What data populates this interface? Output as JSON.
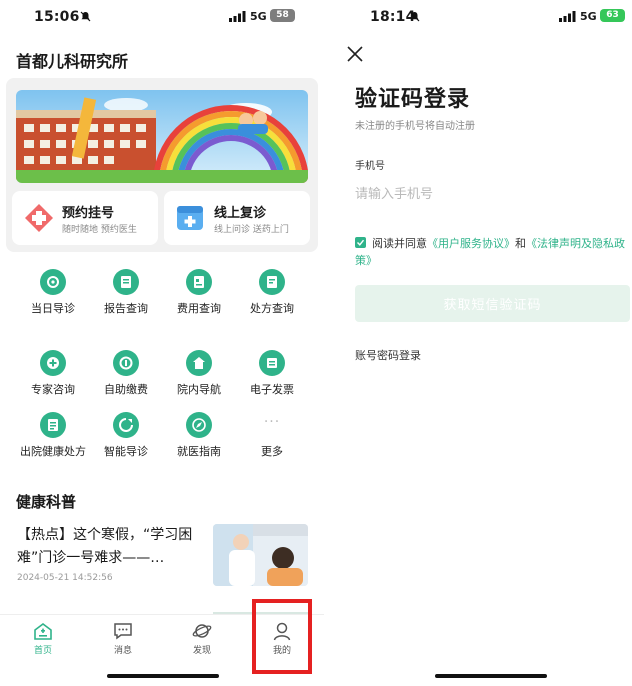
{
  "left": {
    "status": {
      "time": "15:06",
      "network": "5G",
      "battery": "58"
    },
    "app_title": "首都儿科研究所",
    "quick_cards": [
      {
        "title": "预约挂号",
        "subtitle": "随时随地 预约医生"
      },
      {
        "title": "线上复诊",
        "subtitle": "线上问诊 送药上门"
      }
    ],
    "grid": [
      {
        "label": "当日导诊",
        "icon": "guide-icon"
      },
      {
        "label": "报告查询",
        "icon": "report-icon"
      },
      {
        "label": "费用查询",
        "icon": "fee-icon"
      },
      {
        "label": "处方查询",
        "icon": "prescription-icon"
      },
      {
        "label": "专家咨询",
        "icon": "consult-icon"
      },
      {
        "label": "自助缴费",
        "icon": "payment-icon"
      },
      {
        "label": "院内导航",
        "icon": "navigation-icon"
      },
      {
        "label": "电子发票",
        "icon": "invoice-icon"
      },
      {
        "label": "出院健康处方",
        "icon": "discharge-icon"
      },
      {
        "label": "智能导诊",
        "icon": "smart-guide-icon"
      },
      {
        "label": "就医指南",
        "icon": "compass-icon"
      },
      {
        "label": "更多",
        "icon": "more-icon"
      }
    ],
    "section_title": "健康科普",
    "news": {
      "title": "【热点】这个寒假，“学习困难”门诊一号难求——…",
      "date": "2024-05-21 14:52:56"
    },
    "tabs": [
      {
        "label": "首页",
        "icon": "home-icon",
        "active": true
      },
      {
        "label": "消息",
        "icon": "message-icon"
      },
      {
        "label": "发现",
        "icon": "planet-icon"
      },
      {
        "label": "我的",
        "icon": "profile-icon"
      }
    ],
    "colors": {
      "accent": "#2fb38a",
      "highlight": "#e52121"
    }
  },
  "right": {
    "status": {
      "time": "18:14",
      "network": "5G",
      "battery": "63"
    },
    "title": "验证码登录",
    "hint": "未注册的手机号将自动注册",
    "phone_label": "手机号",
    "phone_placeholder": "请输入手机号",
    "agreement": {
      "prefix": "阅读并同意",
      "link1": "《用户服务协议》",
      "middle": "和",
      "link2": "《法律声明及隐私政策》",
      "checked": true
    },
    "sms_button": "获取短信验证码",
    "password_login": "账号密码登录"
  }
}
